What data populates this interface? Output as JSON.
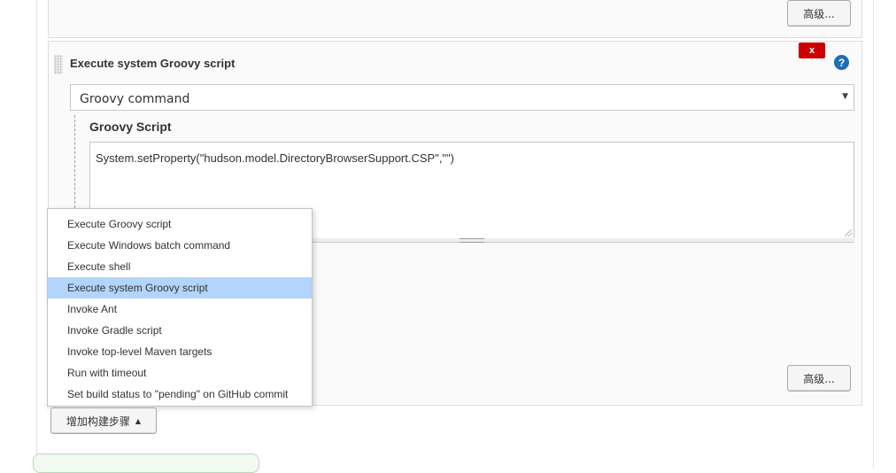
{
  "top_panel": {
    "advanced_button": "高级..."
  },
  "build_step": {
    "title": "Execute system Groovy script",
    "delete_label": "x",
    "help_label": "?",
    "select_value": "Groovy command",
    "select_arrow": "▼",
    "script_label": "Groovy Script",
    "script_text": "System.setProperty(\"hudson.model.DirectoryBrowserSupport.CSP\",\"\")",
    "advanced_button": "高级..."
  },
  "add_step": {
    "label": "增加构建步骤",
    "caret": "▲"
  },
  "menu": {
    "items": [
      {
        "label": "Execute Groovy script"
      },
      {
        "label": "Execute Windows batch command"
      },
      {
        "label": "Execute shell"
      },
      {
        "label": "Execute system Groovy script"
      },
      {
        "label": "Invoke Ant"
      },
      {
        "label": "Invoke Gradle script"
      },
      {
        "label": "Invoke top-level Maven targets"
      },
      {
        "label": "Run with timeout"
      },
      {
        "label": "Set build status to \"pending\" on GitHub commit"
      }
    ],
    "selected_index": 3
  },
  "colors": {
    "delete": "#cc0000",
    "help": "#1f6db5",
    "menu_highlight": "#b3d4fc"
  }
}
